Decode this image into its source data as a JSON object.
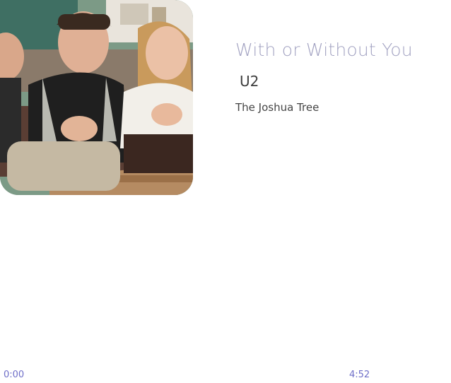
{
  "player": {
    "track_title": "With or Without You",
    "artist": "U2",
    "album": "The Joshua Tree",
    "time_elapsed": "0:00",
    "time_total": "4:52",
    "progress_fraction": 0.0
  },
  "colors": {
    "title": "#a3a3c2",
    "artist": "#3d3d3d",
    "album": "#454545",
    "time": "#6e6ec8",
    "background": "#ffffff"
  }
}
